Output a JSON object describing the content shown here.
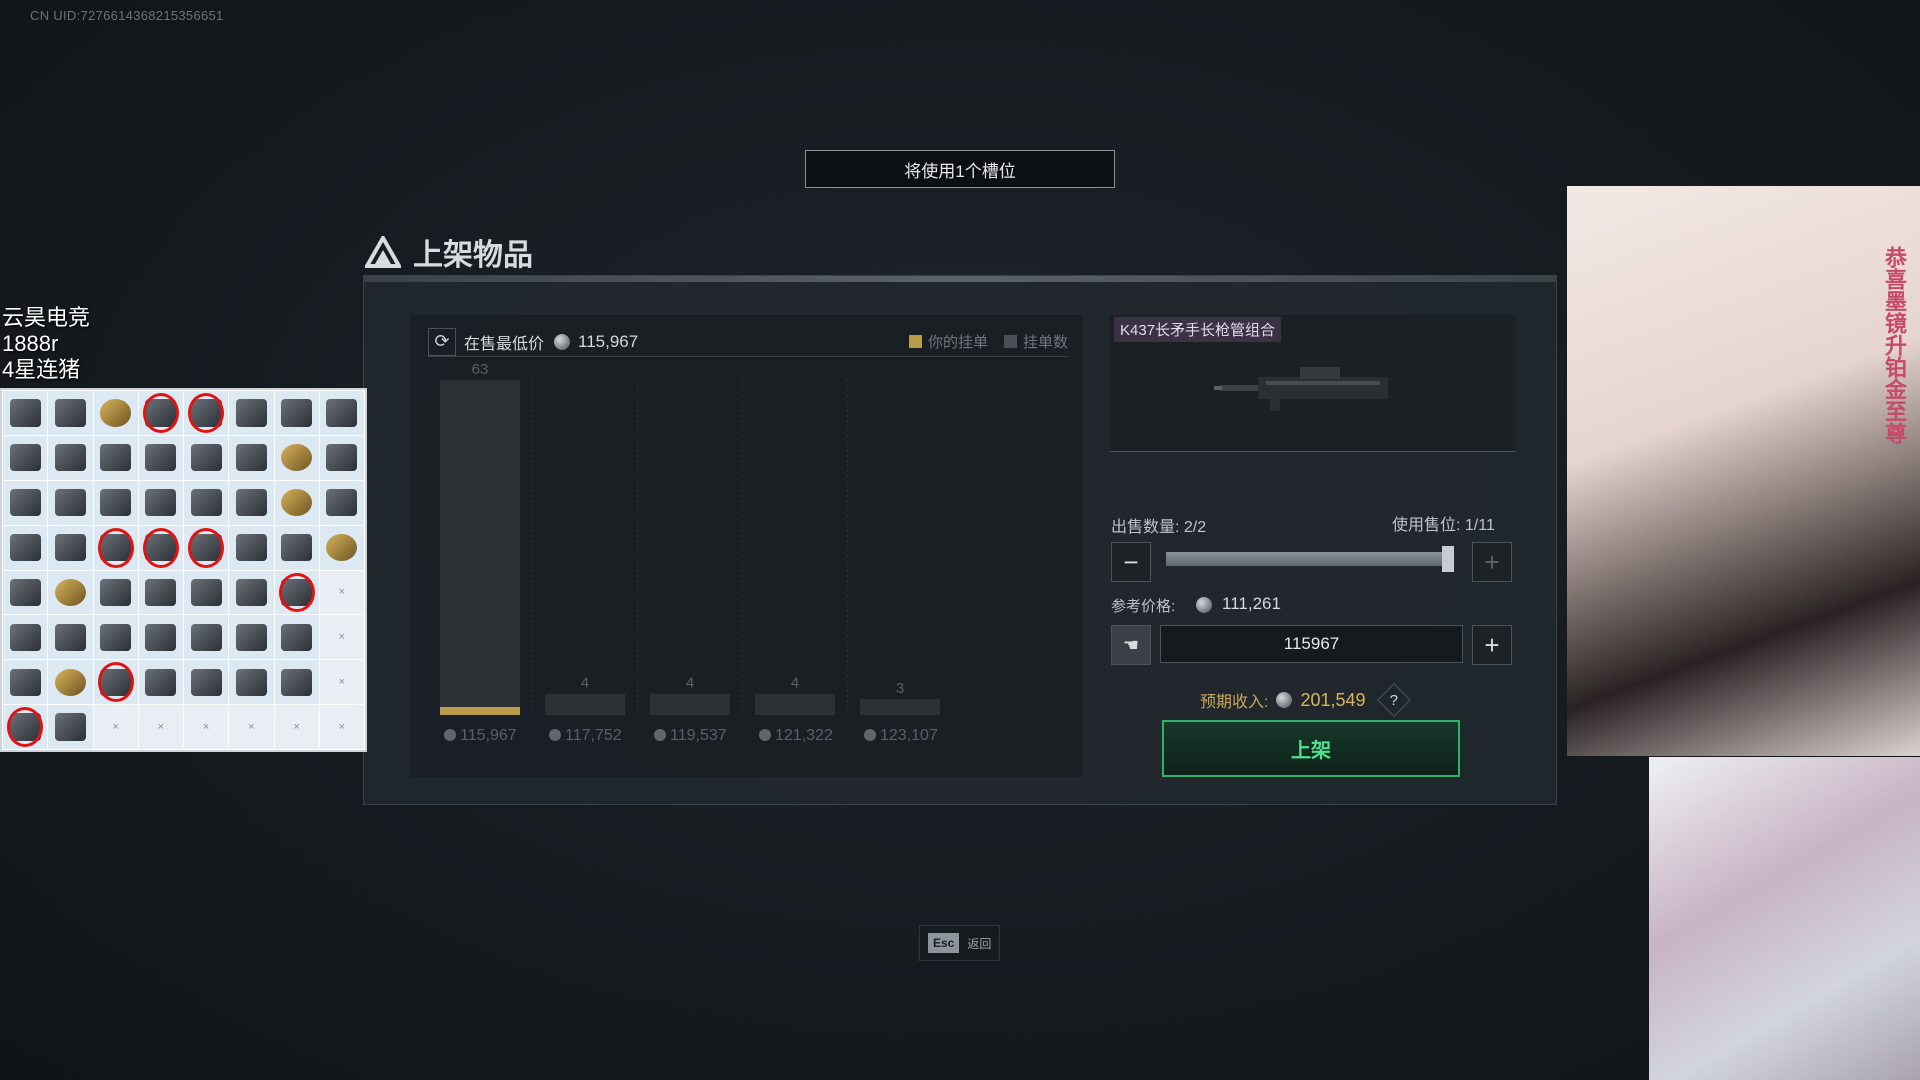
{
  "uid": "CN UID:7276614368215356651",
  "slot_notice": "将使用1个槽位",
  "dialog_title": "上架物品",
  "chart_header": {
    "label": "在售最低价",
    "price": "115,967",
    "legend_yours": "你的挂单",
    "legend_count": "挂单数"
  },
  "chart_data": {
    "type": "bar",
    "categories": [
      "115,967",
      "117,752",
      "119,537",
      "121,322",
      "123,107"
    ],
    "values": [
      63,
      4,
      4,
      4,
      3
    ],
    "highlight_index": 0,
    "colors": {
      "bar": "#2d3136",
      "highlight": "#b89c4a",
      "label": "#59606a"
    }
  },
  "item": {
    "name": "K437长矛手长枪管组合"
  },
  "sell": {
    "qty_label": "出售数量:",
    "qty_value": "2/2",
    "slots_label": "使用售位:",
    "slots_value": "1/11",
    "qty_fraction": 1.0,
    "ref_label": "参考价格:",
    "ref_price": "111,261",
    "price_input": "115967",
    "income_label": "预期收入:",
    "income_value": "201,549",
    "help": "?",
    "submit": "上架",
    "minus": "−",
    "plus": "+"
  },
  "esc": {
    "key": "Esc",
    "label": "返回"
  },
  "overlay": {
    "line1": "云昊电竞",
    "line2": "1888r",
    "line3": "4星连猪"
  },
  "loot": {
    "empty_mark": "×",
    "cells": [
      "i",
      "i",
      "g",
      "c",
      "c",
      "i",
      "i",
      "i",
      "i",
      "i",
      "i",
      "i",
      "i",
      "i",
      "g",
      "i",
      "i",
      "i",
      "i",
      "i",
      "i",
      "i",
      "g",
      "i",
      "i",
      "i",
      "c",
      "c",
      "c",
      "i",
      "i",
      "g",
      "i",
      "g",
      "i",
      "i",
      "i",
      "i",
      "c",
      "x",
      "i",
      "i",
      "i",
      "i",
      "i",
      "i",
      "i",
      "x",
      "i",
      "g",
      "c",
      "i",
      "i",
      "i",
      "i",
      "x",
      "c",
      "i",
      "x",
      "x",
      "x",
      "x",
      "x",
      "x"
    ]
  },
  "cam_label": "恭喜墨镜升铂金至尊"
}
